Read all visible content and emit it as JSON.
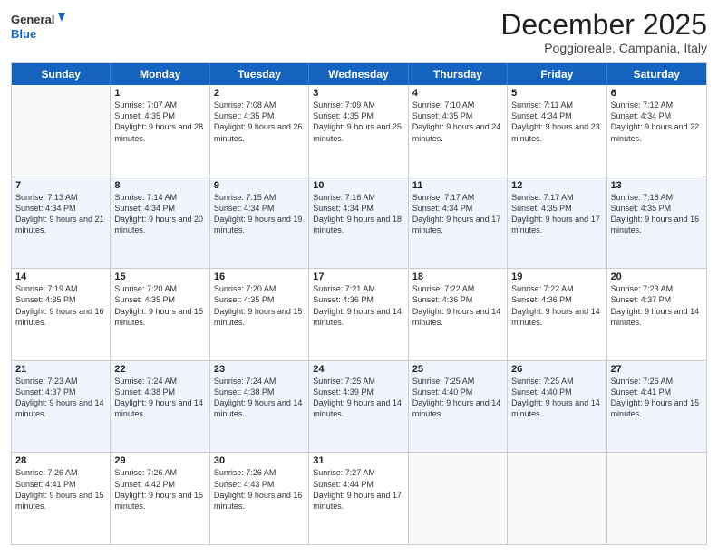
{
  "header": {
    "logo_general": "General",
    "logo_blue": "Blue",
    "month_title": "December 2025",
    "location": "Poggioreale, Campania, Italy"
  },
  "days_of_week": [
    "Sunday",
    "Monday",
    "Tuesday",
    "Wednesday",
    "Thursday",
    "Friday",
    "Saturday"
  ],
  "weeks": [
    [
      {
        "day": "",
        "sunrise": "",
        "sunset": "",
        "daylight": ""
      },
      {
        "day": "1",
        "sunrise": "Sunrise: 7:07 AM",
        "sunset": "Sunset: 4:35 PM",
        "daylight": "Daylight: 9 hours and 28 minutes."
      },
      {
        "day": "2",
        "sunrise": "Sunrise: 7:08 AM",
        "sunset": "Sunset: 4:35 PM",
        "daylight": "Daylight: 9 hours and 26 minutes."
      },
      {
        "day": "3",
        "sunrise": "Sunrise: 7:09 AM",
        "sunset": "Sunset: 4:35 PM",
        "daylight": "Daylight: 9 hours and 25 minutes."
      },
      {
        "day": "4",
        "sunrise": "Sunrise: 7:10 AM",
        "sunset": "Sunset: 4:35 PM",
        "daylight": "Daylight: 9 hours and 24 minutes."
      },
      {
        "day": "5",
        "sunrise": "Sunrise: 7:11 AM",
        "sunset": "Sunset: 4:34 PM",
        "daylight": "Daylight: 9 hours and 23 minutes."
      },
      {
        "day": "6",
        "sunrise": "Sunrise: 7:12 AM",
        "sunset": "Sunset: 4:34 PM",
        "daylight": "Daylight: 9 hours and 22 minutes."
      }
    ],
    [
      {
        "day": "7",
        "sunrise": "Sunrise: 7:13 AM",
        "sunset": "Sunset: 4:34 PM",
        "daylight": "Daylight: 9 hours and 21 minutes."
      },
      {
        "day": "8",
        "sunrise": "Sunrise: 7:14 AM",
        "sunset": "Sunset: 4:34 PM",
        "daylight": "Daylight: 9 hours and 20 minutes."
      },
      {
        "day": "9",
        "sunrise": "Sunrise: 7:15 AM",
        "sunset": "Sunset: 4:34 PM",
        "daylight": "Daylight: 9 hours and 19 minutes."
      },
      {
        "day": "10",
        "sunrise": "Sunrise: 7:16 AM",
        "sunset": "Sunset: 4:34 PM",
        "daylight": "Daylight: 9 hours and 18 minutes."
      },
      {
        "day": "11",
        "sunrise": "Sunrise: 7:17 AM",
        "sunset": "Sunset: 4:34 PM",
        "daylight": "Daylight: 9 hours and 17 minutes."
      },
      {
        "day": "12",
        "sunrise": "Sunrise: 7:17 AM",
        "sunset": "Sunset: 4:35 PM",
        "daylight": "Daylight: 9 hours and 17 minutes."
      },
      {
        "day": "13",
        "sunrise": "Sunrise: 7:18 AM",
        "sunset": "Sunset: 4:35 PM",
        "daylight": "Daylight: 9 hours and 16 minutes."
      }
    ],
    [
      {
        "day": "14",
        "sunrise": "Sunrise: 7:19 AM",
        "sunset": "Sunset: 4:35 PM",
        "daylight": "Daylight: 9 hours and 16 minutes."
      },
      {
        "day": "15",
        "sunrise": "Sunrise: 7:20 AM",
        "sunset": "Sunset: 4:35 PM",
        "daylight": "Daylight: 9 hours and 15 minutes."
      },
      {
        "day": "16",
        "sunrise": "Sunrise: 7:20 AM",
        "sunset": "Sunset: 4:35 PM",
        "daylight": "Daylight: 9 hours and 15 minutes."
      },
      {
        "day": "17",
        "sunrise": "Sunrise: 7:21 AM",
        "sunset": "Sunset: 4:36 PM",
        "daylight": "Daylight: 9 hours and 14 minutes."
      },
      {
        "day": "18",
        "sunrise": "Sunrise: 7:22 AM",
        "sunset": "Sunset: 4:36 PM",
        "daylight": "Daylight: 9 hours and 14 minutes."
      },
      {
        "day": "19",
        "sunrise": "Sunrise: 7:22 AM",
        "sunset": "Sunset: 4:36 PM",
        "daylight": "Daylight: 9 hours and 14 minutes."
      },
      {
        "day": "20",
        "sunrise": "Sunrise: 7:23 AM",
        "sunset": "Sunset: 4:37 PM",
        "daylight": "Daylight: 9 hours and 14 minutes."
      }
    ],
    [
      {
        "day": "21",
        "sunrise": "Sunrise: 7:23 AM",
        "sunset": "Sunset: 4:37 PM",
        "daylight": "Daylight: 9 hours and 14 minutes."
      },
      {
        "day": "22",
        "sunrise": "Sunrise: 7:24 AM",
        "sunset": "Sunset: 4:38 PM",
        "daylight": "Daylight: 9 hours and 14 minutes."
      },
      {
        "day": "23",
        "sunrise": "Sunrise: 7:24 AM",
        "sunset": "Sunset: 4:38 PM",
        "daylight": "Daylight: 9 hours and 14 minutes."
      },
      {
        "day": "24",
        "sunrise": "Sunrise: 7:25 AM",
        "sunset": "Sunset: 4:39 PM",
        "daylight": "Daylight: 9 hours and 14 minutes."
      },
      {
        "day": "25",
        "sunrise": "Sunrise: 7:25 AM",
        "sunset": "Sunset: 4:40 PM",
        "daylight": "Daylight: 9 hours and 14 minutes."
      },
      {
        "day": "26",
        "sunrise": "Sunrise: 7:25 AM",
        "sunset": "Sunset: 4:40 PM",
        "daylight": "Daylight: 9 hours and 14 minutes."
      },
      {
        "day": "27",
        "sunrise": "Sunrise: 7:26 AM",
        "sunset": "Sunset: 4:41 PM",
        "daylight": "Daylight: 9 hours and 15 minutes."
      }
    ],
    [
      {
        "day": "28",
        "sunrise": "Sunrise: 7:26 AM",
        "sunset": "Sunset: 4:41 PM",
        "daylight": "Daylight: 9 hours and 15 minutes."
      },
      {
        "day": "29",
        "sunrise": "Sunrise: 7:26 AM",
        "sunset": "Sunset: 4:42 PM",
        "daylight": "Daylight: 9 hours and 15 minutes."
      },
      {
        "day": "30",
        "sunrise": "Sunrise: 7:26 AM",
        "sunset": "Sunset: 4:43 PM",
        "daylight": "Daylight: 9 hours and 16 minutes."
      },
      {
        "day": "31",
        "sunrise": "Sunrise: 7:27 AM",
        "sunset": "Sunset: 4:44 PM",
        "daylight": "Daylight: 9 hours and 17 minutes."
      },
      {
        "day": "",
        "sunrise": "",
        "sunset": "",
        "daylight": ""
      },
      {
        "day": "",
        "sunrise": "",
        "sunset": "",
        "daylight": ""
      },
      {
        "day": "",
        "sunrise": "",
        "sunset": "",
        "daylight": ""
      }
    ]
  ]
}
